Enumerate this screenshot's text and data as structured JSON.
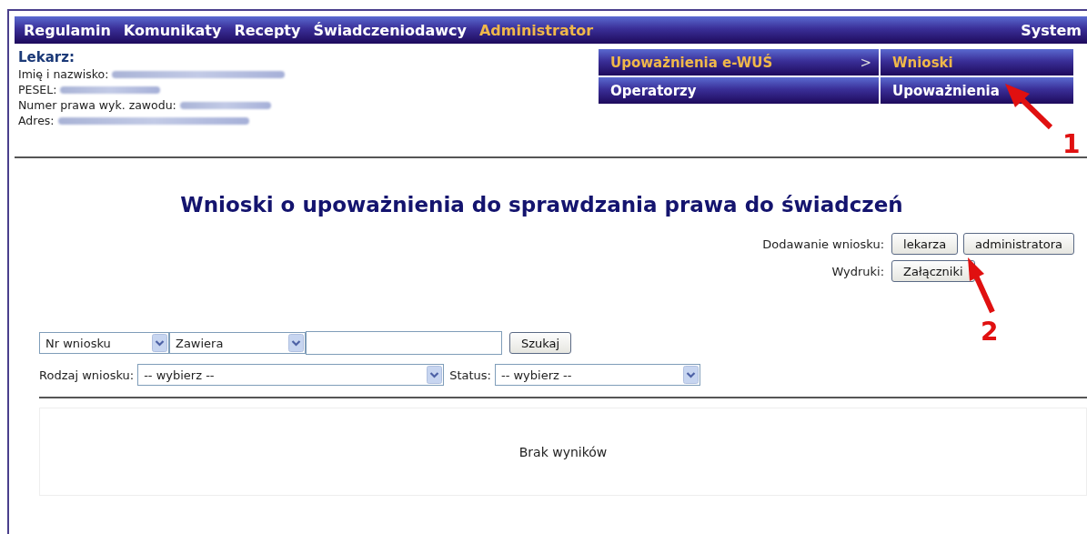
{
  "nav": {
    "items": [
      {
        "label": "Regulamin",
        "selected": false
      },
      {
        "label": "Komunikaty",
        "selected": false
      },
      {
        "label": "Recepty",
        "selected": false
      },
      {
        "label": "Świadczeniodawcy",
        "selected": false
      },
      {
        "label": "Administrator",
        "selected": true
      }
    ],
    "right_item": {
      "label": "System",
      "selected": false
    }
  },
  "doctor": {
    "heading": "Lekarz:",
    "fields": [
      {
        "label": "Imię i nazwisko:"
      },
      {
        "label": "PESEL:"
      },
      {
        "label": "Numer prawa wyk. zawodu:"
      },
      {
        "label": "Adres:"
      }
    ]
  },
  "submenu": {
    "rows": [
      {
        "left": {
          "label": "Upoważnienia e-WUŚ",
          "selected": true,
          "arrow": ">"
        },
        "right": {
          "label": "Wnioski",
          "selected": true
        }
      },
      {
        "left": {
          "label": "Operatorzy",
          "selected": false
        },
        "right": {
          "label": "Upoważnienia",
          "selected": false
        }
      }
    ]
  },
  "title": "Wnioski o upoważnienia do sprawdzania prawa do świadczeń",
  "actions": [
    {
      "label": "Dodawanie wniosku:",
      "buttons": [
        "lekarza",
        "administratora"
      ]
    },
    {
      "label": "Wydruki:",
      "buttons": [
        "Załączniki"
      ]
    }
  ],
  "search": {
    "field_select": "Nr wniosku",
    "mode_select": "Zawiera",
    "button": "Szukaj"
  },
  "filters": [
    {
      "label": "Rodzaj wniosku:",
      "value": "-- wybierz --"
    },
    {
      "label": "Status:",
      "value": "-- wybierz --"
    }
  ],
  "results": {
    "message": "Brak wyników"
  },
  "annotations": [
    {
      "number": "1"
    },
    {
      "number": "2"
    }
  ]
}
